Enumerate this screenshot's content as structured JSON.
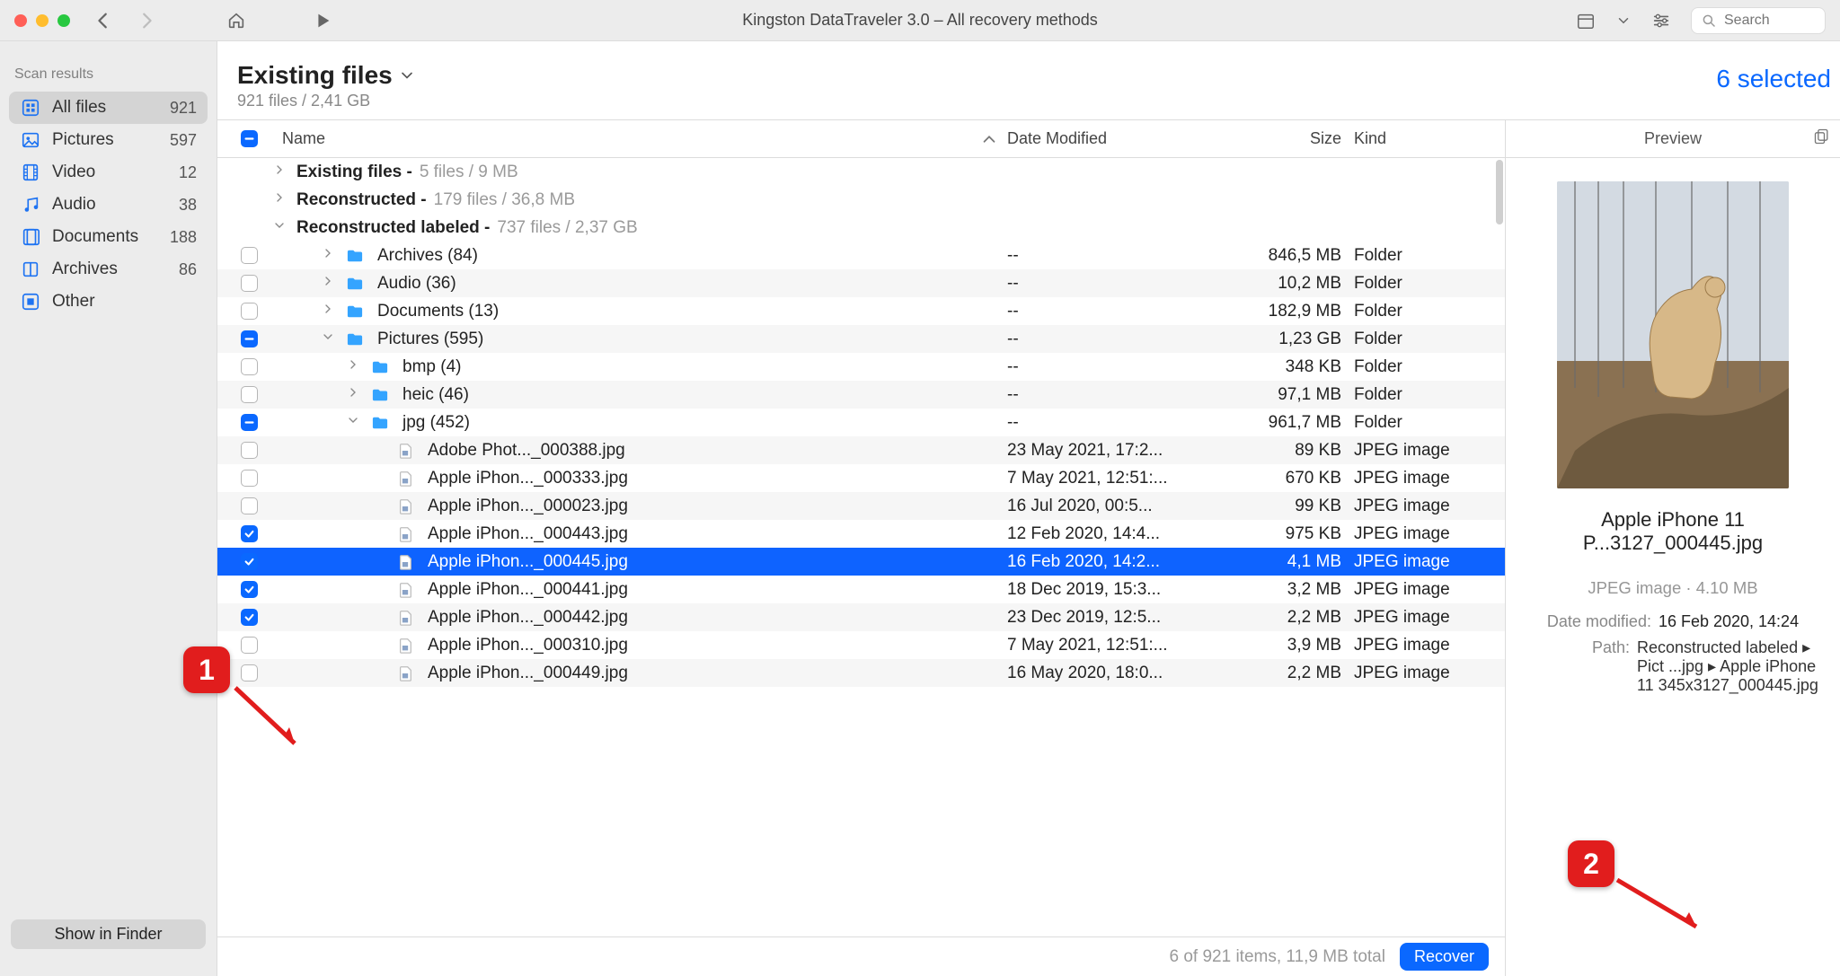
{
  "window": {
    "title": "Kingston DataTraveler 3.0 – All recovery methods"
  },
  "search": {
    "placeholder": "Search"
  },
  "sidebar": {
    "title": "Scan results",
    "items": [
      {
        "label": "All files",
        "badge": "921",
        "icon": "grid-icon",
        "active": true
      },
      {
        "label": "Pictures",
        "badge": "597",
        "icon": "image-icon",
        "active": false
      },
      {
        "label": "Video",
        "badge": "12",
        "icon": "film-icon",
        "active": false
      },
      {
        "label": "Audio",
        "badge": "38",
        "icon": "music-icon",
        "active": false
      },
      {
        "label": "Documents",
        "badge": "188",
        "icon": "doc-icon",
        "active": false
      },
      {
        "label": "Archives",
        "badge": "86",
        "icon": "archive-icon",
        "active": false
      },
      {
        "label": "Other",
        "badge": "",
        "icon": "other-icon",
        "active": false
      }
    ],
    "finder_button": "Show in Finder"
  },
  "header": {
    "title": "Existing files",
    "subtitle": "921 files / 2,41 GB",
    "selected_label": "6 selected"
  },
  "columns": {
    "name": "Name",
    "date": "Date Modified",
    "size": "Size",
    "kind": "Kind"
  },
  "groups": [
    {
      "label": "Existing files",
      "meta": "5 files / 9 MB",
      "expanded": false
    },
    {
      "label": "Reconstructed",
      "meta": "179 files / 36,8 MB",
      "expanded": false
    },
    {
      "label": "Reconstructed labeled",
      "meta": "737 files / 2,37 GB",
      "expanded": true
    }
  ],
  "rows": [
    {
      "indent": 1,
      "check": "off",
      "expander": "right",
      "type": "folder",
      "name": "Archives (84)",
      "date": "--",
      "size": "846,5 MB",
      "kind": "Folder"
    },
    {
      "indent": 1,
      "check": "off",
      "expander": "right",
      "type": "folder",
      "name": "Audio (36)",
      "date": "--",
      "size": "10,2 MB",
      "kind": "Folder"
    },
    {
      "indent": 1,
      "check": "off",
      "expander": "right",
      "type": "folder",
      "name": "Documents (13)",
      "date": "--",
      "size": "182,9 MB",
      "kind": "Folder"
    },
    {
      "indent": 1,
      "check": "mixed",
      "expander": "down",
      "type": "folder",
      "name": "Pictures (595)",
      "date": "--",
      "size": "1,23 GB",
      "kind": "Folder"
    },
    {
      "indent": 2,
      "check": "off",
      "expander": "right",
      "type": "folder",
      "name": "bmp (4)",
      "date": "--",
      "size": "348 KB",
      "kind": "Folder"
    },
    {
      "indent": 2,
      "check": "off",
      "expander": "right",
      "type": "folder",
      "name": "heic (46)",
      "date": "--",
      "size": "97,1 MB",
      "kind": "Folder"
    },
    {
      "indent": 2,
      "check": "mixed",
      "expander": "down",
      "type": "folder",
      "name": "jpg (452)",
      "date": "--",
      "size": "961,7 MB",
      "kind": "Folder"
    },
    {
      "indent": 3,
      "check": "off",
      "expander": "",
      "type": "file",
      "name": "Adobe Phot..._000388.jpg",
      "date": "23 May 2021, 17:2...",
      "size": "89 KB",
      "kind": "JPEG image"
    },
    {
      "indent": 3,
      "check": "off",
      "expander": "",
      "type": "file",
      "name": "Apple iPhon..._000333.jpg",
      "date": "7 May 2021, 12:51:...",
      "size": "670 KB",
      "kind": "JPEG image"
    },
    {
      "indent": 3,
      "check": "off",
      "expander": "",
      "type": "file",
      "name": "Apple iPhon..._000023.jpg",
      "date": "16 Jul 2020, 00:5...",
      "size": "99 KB",
      "kind": "JPEG image"
    },
    {
      "indent": 3,
      "check": "on",
      "expander": "",
      "type": "file",
      "name": "Apple iPhon..._000443.jpg",
      "date": "12 Feb 2020, 14:4...",
      "size": "975 KB",
      "kind": "JPEG image"
    },
    {
      "indent": 3,
      "check": "on",
      "expander": "",
      "type": "file",
      "name": "Apple iPhon..._000445.jpg",
      "date": "16 Feb 2020, 14:2...",
      "size": "4,1 MB",
      "kind": "JPEG image",
      "selected": true
    },
    {
      "indent": 3,
      "check": "on",
      "expander": "",
      "type": "file",
      "name": "Apple iPhon..._000441.jpg",
      "date": "18 Dec 2019, 15:3...",
      "size": "3,2 MB",
      "kind": "JPEG image"
    },
    {
      "indent": 3,
      "check": "on",
      "expander": "",
      "type": "file",
      "name": "Apple iPhon..._000442.jpg",
      "date": "23 Dec 2019, 12:5...",
      "size": "2,2 MB",
      "kind": "JPEG image"
    },
    {
      "indent": 3,
      "check": "off",
      "expander": "",
      "type": "file",
      "name": "Apple iPhon..._000310.jpg",
      "date": "7 May 2021, 12:51:...",
      "size": "3,9 MB",
      "kind": "JPEG image"
    },
    {
      "indent": 3,
      "check": "off",
      "expander": "",
      "type": "file",
      "name": "Apple iPhon..._000449.jpg",
      "date": "16 May 2020, 18:0...",
      "size": "2,2 MB",
      "kind": "JPEG image"
    }
  ],
  "preview": {
    "title": "Preview",
    "filename": "Apple iPhone 11 P...3127_000445.jpg",
    "sub": "JPEG image · 4.10 MB",
    "date_label": "Date modified:",
    "date_value": "16 Feb 2020, 14:24",
    "path_label": "Path:",
    "path_value": "Reconstructed labeled ▸ Pict ...jpg ▸ Apple iPhone 11 345x3127_000445.jpg"
  },
  "footer": {
    "status": "6 of 921 items, 11,9 MB total",
    "recover": "Recover"
  },
  "callouts": {
    "one": "1",
    "two": "2"
  }
}
